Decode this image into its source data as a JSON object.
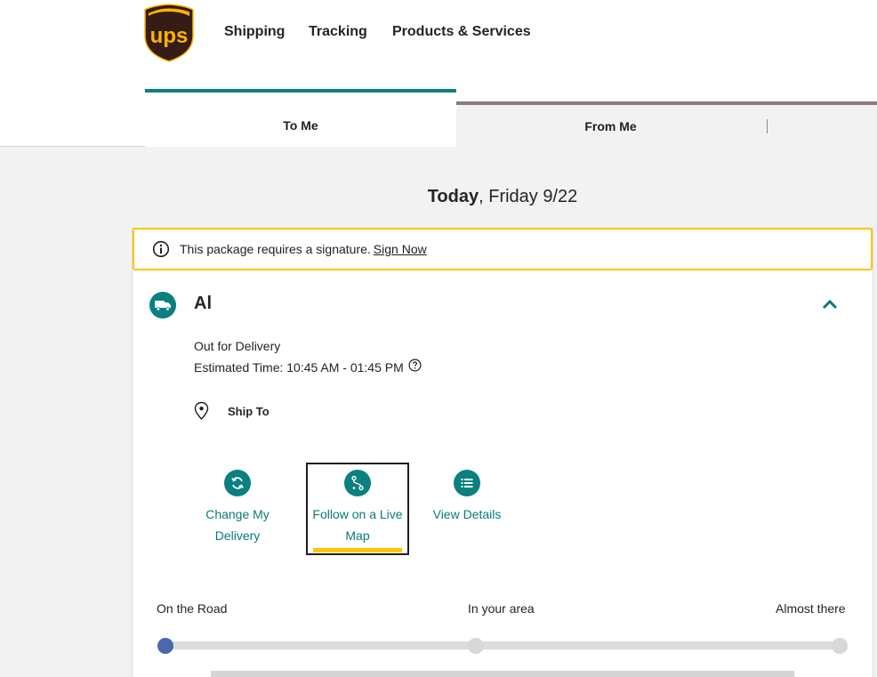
{
  "brand": {
    "logo_text": "ups",
    "colors": {
      "brown": "#351c15",
      "gold": "#ffb500",
      "teal": "#0a8080",
      "alert_border": "#ffc400",
      "progress_active": "#4a69ad"
    }
  },
  "nav": {
    "items": [
      "Shipping",
      "Tracking",
      "Products & Services"
    ]
  },
  "tabs": {
    "to_me": "To Me",
    "from_me": "From Me",
    "selected": "To Me"
  },
  "date": {
    "bold": "Today",
    "rest": ", Friday 9/22"
  },
  "alert": {
    "icon": "info-icon",
    "text": "This package requires a signature.",
    "link": "Sign Now"
  },
  "package": {
    "icon": "truck-icon",
    "name": "Al",
    "status": "Out for Delivery",
    "estimate": "Estimated Time: 10:45 AM - 01:45 PM",
    "ship_to_label": "Ship To"
  },
  "actions": [
    {
      "icon": "refresh-icon",
      "line1": "Change My",
      "line2": "Delivery"
    },
    {
      "icon": "route-icon",
      "line1": "Follow on a Live",
      "line2": "Map",
      "focused": true
    },
    {
      "icon": "list-icon",
      "label": "View Details"
    }
  ],
  "progress": {
    "steps": [
      "On the Road",
      "In your area",
      "Almost there"
    ],
    "current_step": 1
  }
}
